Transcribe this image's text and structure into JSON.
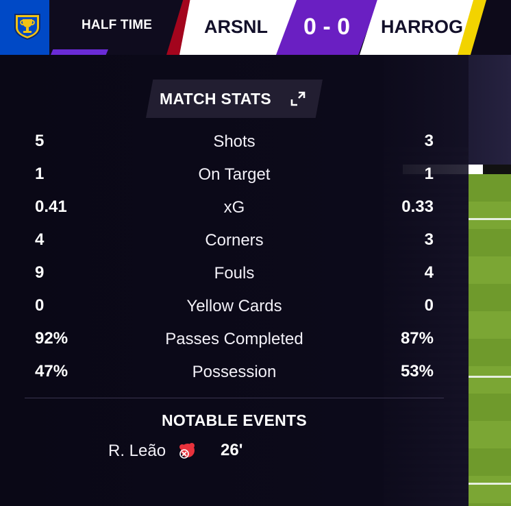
{
  "header": {
    "competition_logo": "trophy-shield-icon",
    "status": "HALF TIME",
    "home_team": "ARSNL",
    "away_team": "HARROG",
    "score": "0 - 0",
    "colors": {
      "logo_bg": "#0049c6",
      "home_accent": "#a3051d",
      "away_accent": "#f2d300",
      "score_bg": "#6a1fc2",
      "status_bar": "#6a2bd6"
    }
  },
  "stats": {
    "title": "MATCH STATS",
    "expand_icon": "expand-icon",
    "rows": [
      {
        "label": "Shots",
        "home": "5",
        "away": "3"
      },
      {
        "label": "On Target",
        "home": "1",
        "away": "1"
      },
      {
        "label": "xG",
        "home": "0.41",
        "away": "0.33"
      },
      {
        "label": "Corners",
        "home": "4",
        "away": "3"
      },
      {
        "label": "Fouls",
        "home": "9",
        "away": "4"
      },
      {
        "label": "Yellow Cards",
        "home": "0",
        "away": "0"
      },
      {
        "label": "Passes Completed",
        "home": "92%",
        "away": "87%"
      },
      {
        "label": "Possession",
        "home": "47%",
        "away": "53%"
      }
    ]
  },
  "events": {
    "title": "NOTABLE EVENTS",
    "items": [
      {
        "player": "R. Leão",
        "icon": "injury-icon",
        "minute": "26'"
      }
    ]
  }
}
